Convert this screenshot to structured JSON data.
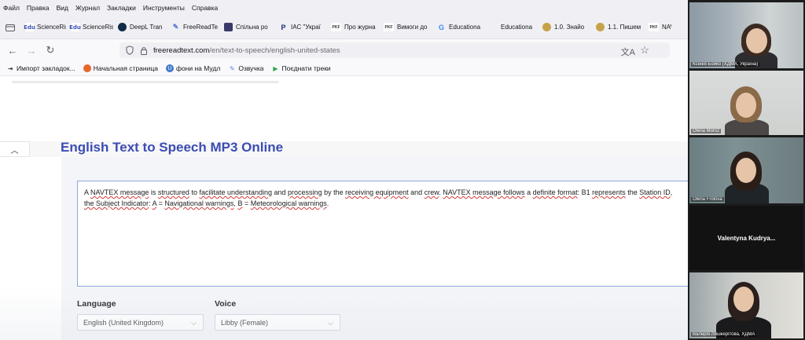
{
  "menu": [
    "Файл",
    "Правка",
    "Вид",
    "Журнал",
    "Закладки",
    "Инструменты",
    "Справка"
  ],
  "tabs": [
    {
      "label": "ScienceRis",
      "icon": "edu-icon"
    },
    {
      "label": "ScienceRis",
      "icon": "edu-icon"
    },
    {
      "label": "DeepL Tran",
      "icon": "deepl-icon"
    },
    {
      "label": "FreeReadTe",
      "icon": "pen-icon"
    },
    {
      "label": "Спільна ро",
      "icon": "ua-icon"
    },
    {
      "label": "IAC \"Украї",
      "icon": "p-icon"
    },
    {
      "label": "Про журна",
      "icon": "pkf-icon"
    },
    {
      "label": "Вимоги до",
      "icon": "pkf-icon"
    },
    {
      "label": "Educationa",
      "icon": "google-icon"
    },
    {
      "label": "Educationa",
      "icon": "none"
    },
    {
      "label": "1.0. Знайо",
      "icon": "round-icon"
    },
    {
      "label": "1.1. Пишем",
      "icon": "round-icon"
    },
    {
      "label": "NAV",
      "icon": "pkf-icon"
    }
  ],
  "pkf_text": "PKF",
  "url": {
    "host": "freereadtext.com",
    "path": "/en/text-to-speech/english-united-states"
  },
  "bookmarks": [
    {
      "label": "Импорт закладок...",
      "icon": "import-icon"
    },
    {
      "label": "Начальная страница",
      "icon": "firefox-icon"
    },
    {
      "label": "фони на Мудл",
      "icon": "u-icon"
    },
    {
      "label": "Озвучка",
      "icon": "pen-icon"
    },
    {
      "label": "Поєднати треки",
      "icon": "play-icon"
    }
  ],
  "page": {
    "title": "English Text to Speech MP3 Online",
    "text": {
      "t1": "A ",
      "s1": "NAVTEX message",
      "t2": " is ",
      "s2": "structured",
      "t3": " to ",
      "s3": "facilitate understanding",
      "t4": " and ",
      "s4": "processing",
      "t5": " by the ",
      "s5": "receiving equipment",
      "t6": " and ",
      "s6": "crew",
      "t7": ". ",
      "s7": "NAVTEX message follows",
      "t8": " a ",
      "s8": "definite format",
      "t9": ": B1 ",
      "s9": "represents",
      "t10": " the ",
      "s10": "Station ID",
      "t11": ", ",
      "s11": "the Subject Indicator",
      "t12": ":  ",
      "s12": "A",
      "t13": " = ",
      "s13": "Navigational warnings",
      "t14": ", ",
      "s14": "B",
      "t15": " = ",
      "s15": "Meteorological warnings",
      "t16": "."
    },
    "language_label": "Language",
    "voice_label": "Voice",
    "language_value": "English (United Kingdom)",
    "voice_value": "Libby (Female)"
  },
  "participants": [
    {
      "name": "Ксенія Бойко (ХДМА, Україна)"
    },
    {
      "name": "Olena Moroz"
    },
    {
      "name": "Olena Frolova"
    },
    {
      "name": "Valentyna  Kudrya..."
    },
    {
      "name": "Валерія Ляшкерітова, ХДМА"
    }
  ]
}
